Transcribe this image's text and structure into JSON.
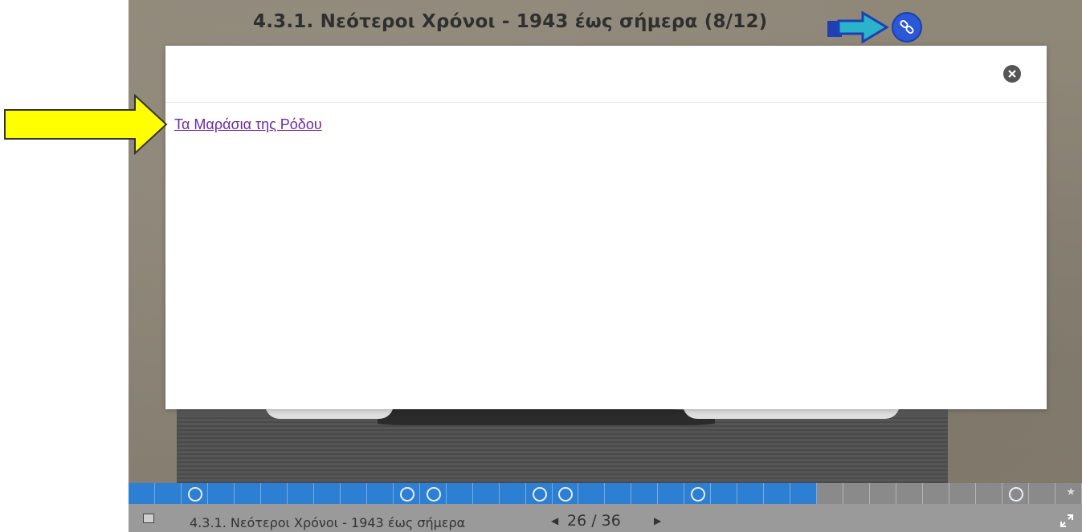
{
  "slide": {
    "title": "4.3.1. Νεότεροι Χρόνοι - 1943 έως σήμερα (8/12)",
    "nav_icon": "blue-arrow-icon",
    "link_icon": "link-icon"
  },
  "modal": {
    "close_icon": "close-icon",
    "link_text": "Τα Μαράσια της Ρόδου"
  },
  "annotation": {
    "icon": "yellow-arrow-icon",
    "color": "#ffff00"
  },
  "progress": {
    "total_cells": 36,
    "current": 26,
    "dot_cells": [
      2,
      10,
      11,
      15,
      16,
      21,
      33
    ]
  },
  "footer": {
    "slides_icon": "slides-icon",
    "title": "4.3.1. Νεότεροι Χρόνοι - 1943 έως σήμερα",
    "page_counter": "26 / 36",
    "prev_icon": "◀",
    "next_icon": "▶",
    "star_icon": "★",
    "fullscreen_icon": "fullscreen-icon"
  },
  "colors": {
    "accent_blue": "#2d7fd3",
    "link_purple": "#6a2a9f",
    "link_icon_bg": "#2b57d9"
  }
}
